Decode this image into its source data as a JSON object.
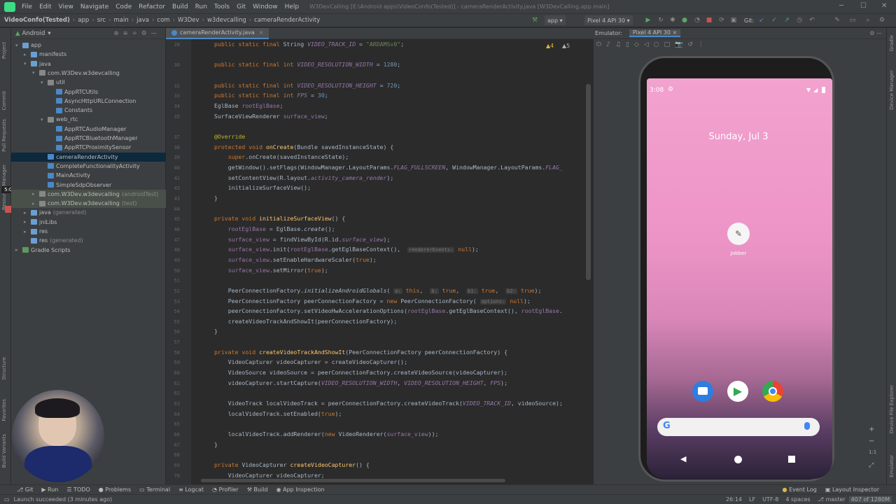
{
  "menu": {
    "items": [
      "File",
      "Edit",
      "View",
      "Navigate",
      "Code",
      "Refactor",
      "Build",
      "Run",
      "Tools",
      "Git",
      "Window",
      "Help"
    ],
    "window_title": "W3DevCalling [E:\\Android apps\\VideoConfo(Tested)] - cameraRenderActivity.java [W3DevCalling.app.main]"
  },
  "breadcrumb": [
    "VideoConfo(Tested)",
    "app",
    "src",
    "main",
    "java",
    "com",
    "W3Dev",
    "w3devcalling",
    "cameraRenderActivity"
  ],
  "toolbar": {
    "config": "app",
    "device": "Pixel 4 API 30",
    "git": "Git:"
  },
  "project": {
    "view": "Android",
    "nodes": [
      {
        "label": "app",
        "depth": 0,
        "arrow": "▾",
        "color": "#6a9fd4"
      },
      {
        "label": "manifests",
        "depth": 1,
        "arrow": "▸",
        "color": "#6a9fd4"
      },
      {
        "label": "java",
        "depth": 1,
        "arrow": "▾",
        "color": "#6a9fd4"
      },
      {
        "label": "com.W3Dev.w3devcalling",
        "depth": 2,
        "arrow": "▾",
        "color": "#888"
      },
      {
        "label": "util",
        "depth": 3,
        "arrow": "▾",
        "color": "#888"
      },
      {
        "label": "AppRTCUtils",
        "depth": 4,
        "arrow": "",
        "color": "#4a88c7"
      },
      {
        "label": "AsyncHttpURLConnection",
        "depth": 4,
        "arrow": "",
        "color": "#4a88c7"
      },
      {
        "label": "Constants",
        "depth": 4,
        "arrow": "",
        "color": "#4a88c7"
      },
      {
        "label": "web_rtc",
        "depth": 3,
        "arrow": "▾",
        "color": "#888"
      },
      {
        "label": "AppRTCAudioManager",
        "depth": 4,
        "arrow": "",
        "color": "#4a88c7"
      },
      {
        "label": "AppRTCBluetoothManager",
        "depth": 4,
        "arrow": "",
        "color": "#4a88c7"
      },
      {
        "label": "AppRTCProximitySensor",
        "depth": 4,
        "arrow": "",
        "color": "#4a88c7"
      },
      {
        "label": "cameraRenderActivity",
        "depth": 3,
        "arrow": "",
        "color": "#4a88c7"
      },
      {
        "label": "CompleteFunctionalityActivity",
        "depth": 3,
        "arrow": "",
        "color": "#4a88c7"
      },
      {
        "label": "MainActivity",
        "depth": 3,
        "arrow": "",
        "color": "#4a88c7"
      },
      {
        "label": "SimpleSdpObserver",
        "depth": 3,
        "arrow": "",
        "color": "#4a88c7"
      },
      {
        "label": "com.W3Dev.w3devcalling",
        "suffix": "(androidTest)",
        "depth": 2,
        "arrow": "▸",
        "color": "#888"
      },
      {
        "label": "com.W3Dev.w3devcalling",
        "suffix": "(test)",
        "depth": 2,
        "arrow": "▸",
        "color": "#888"
      },
      {
        "label": "java",
        "suffix": "(generated)",
        "depth": 1,
        "arrow": "▸",
        "color": "#6a9fd4"
      },
      {
        "label": "jniLibs",
        "depth": 1,
        "arrow": "▸",
        "color": "#6a9fd4"
      },
      {
        "label": "res",
        "depth": 1,
        "arrow": "▸",
        "color": "#6a9fd4"
      },
      {
        "label": "res",
        "suffix": "(generated)",
        "depth": 1,
        "arrow": "",
        "color": "#6a9fd4"
      },
      {
        "label": "Gradle Scripts",
        "depth": 0,
        "arrow": "▸",
        "color": "#5b9a5b"
      }
    ]
  },
  "editor": {
    "tab": "cameraRenderActivity.java",
    "warnings": "▲4",
    "weak": "▲5",
    "line_numbers": [
      "28",
      "",
      "30",
      "",
      "32",
      "33",
      "34",
      "35",
      "",
      "37",
      "38",
      "39",
      "40",
      "41",
      "42",
      "43",
      "44",
      "45",
      "46",
      "47",
      "48",
      "49",
      "50",
      "51",
      "52",
      "53",
      "54",
      "55",
      "56",
      "57",
      "58",
      "59",
      "60",
      "61",
      "62",
      "63",
      "64",
      "65",
      "66",
      "67",
      "68",
      "69",
      "70"
    ]
  },
  "code_lines": [
    "<span class='kw'>public static final </span>String <span class='cst'>VIDEO_TRACK_ID</span> = <span class='str'>\"ARDAMSv0\"</span>;",
    "",
    "<span class='kw'>public static final int </span><span class='cst'>VIDEO_RESOLUTION_WIDTH</span> = <span class='num'>1280</span>;",
    "",
    "<span class='kw'>public static final int </span><span class='cst'>VIDEO_RESOLUTION_HEIGHT</span> = <span class='num'>720</span>;",
    "<span class='kw'>public static final int </span><span class='cst'>FPS</span> = <span class='num'>30</span>;",
    "EglBase <span class='fld'>rootEglBase</span>;",
    "SurfaceViewRenderer <span class='fld'>surface_view</span>;",
    "",
    "<span class='an'>@Override</span>",
    "<span class='kw'>protected void </span><span class='fn'>onCreate</span>(Bundle savedInstanceState) {",
    "    <span class='kw'>super</span>.onCreate(savedInstanceState);",
    "    getWindow().setFlags(WindowManager.LayoutParams.<span class='cst'>FLAG_FULLSCREEN</span>, WindowManager.LayoutParams.<span class='cst'>FLAG_</span>",
    "    setContentView(R.layout.<span class='cst'>activity_camera_render</span>);",
    "    initializeSurfaceView();",
    "}",
    "",
    "<span class='kw'>private void </span><span class='fn'>initializeSurfaceView</span>() {",
    "    <span class='fld'>rootEglBase</span> = EglBase.<span class='it'>create</span>();",
    "    <span class='fld'>surface_view</span> = findViewById(R.id.<span class='cst'>surface_view</span>);",
    "    <span class='fld'>surface_view</span>.init(<span class='fld'>rootEglBase</span>.getEglBaseContext(),  <span class='hint'>rendererEvents:</span> <span class='kw'>null</span>);",
    "    <span class='fld'>surface_view</span>.setEnableHardwareScaler(<span class='kw'>true</span>);",
    "    <span class='fld'>surface_view</span>.setMirror(<span class='kw'>true</span>);",
    "",
    "    PeerConnectionFactory.<span class='it'>initializeAndroidGlobals</span>( <span class='hint'>o:</span> <span class='kw'>this</span>,  <span class='hint'>b:</span> <span class='kw'>true</span>,  <span class='hint'>b1:</span> <span class='kw'>true</span>,  <span class='hint'>b2:</span> <span class='kw'>true</span>);",
    "    PeerConnectionFactory peerConnectionFactory = <span class='kw'>new </span>PeerConnectionFactory( <span class='hint'>options:</span> <span class='kw'>null</span>);",
    "    peerConnectionFactory.setVideoHwAccelerationOptions(<span class='fld'>rootEglBase</span>.getEglBaseContext(), <span class='fld'>rootEglBase</span>.",
    "    createVideoTrackAndShowIt(peerConnectionFactory);",
    "}",
    "",
    "<span class='kw'>private void </span><span class='fn'>createVideoTrackAndShowIt</span>(PeerConnectionFactory peerConnectionFactory) {",
    "    VideoCapturer videoCapturer = createVideoCapturer();",
    "    VideoSource videoSource = peerConnectionFactory.createVideoSource(videoCapturer);",
    "    videoCapturer.startCapture(<span class='cst'>VIDEO_RESOLUTION_WIDTH</span>, <span class='cst'>VIDEO_RESOLUTION_HEIGHT</span>, <span class='cst'>FPS</span>);",
    "",
    "    VideoTrack localVideoTrack = peerConnectionFactory.createVideoTrack(<span class='cst'>VIDEO_TRACK_ID</span>, videoSource);",
    "    localVideoTrack.setEnabled(<span class='kw'>true</span>);",
    "",
    "    localVideoTrack.addRenderer(<span class='kw'>new </span>VideoRenderer(<span class='fld'>surface_view</span>));",
    "}",
    "",
    "<span class='kw'>private </span>VideoCapturer <span class='fn'>createVideoCapturer</span>() {",
    "    VideoCapturer videoCapturer;"
  ],
  "emulator": {
    "label": "Emulator:",
    "tab": "Pixel 4 API 30"
  },
  "phone": {
    "time": "3:08",
    "date": "Sunday, Jul 3",
    "app_label": "Jobber"
  },
  "left_strip": [
    "Project",
    "Commit",
    "Pull Requests",
    "Resource Manager",
    "Structure",
    "Favorites",
    "Build Variants"
  ],
  "right_strip": [
    "Gradle",
    "Device Manager",
    "Device File Explorer",
    "Emulator"
  ],
  "bottom_tabs": [
    "Git",
    "Run",
    "TODO",
    "Problems",
    "Terminal",
    "Logcat",
    "Profiler",
    "Build",
    "App Inspection"
  ],
  "bottom_right": [
    "Event Log",
    "Layout Inspector"
  ],
  "status": {
    "message": "Launch succeeded (3 minutes ago)",
    "position": "26:14",
    "line_sep": "LF",
    "encoding": "UTF-8",
    "indent": "4 spaces",
    "branch": "master",
    "memory": "407 of 1280M"
  },
  "timer": "5:00"
}
